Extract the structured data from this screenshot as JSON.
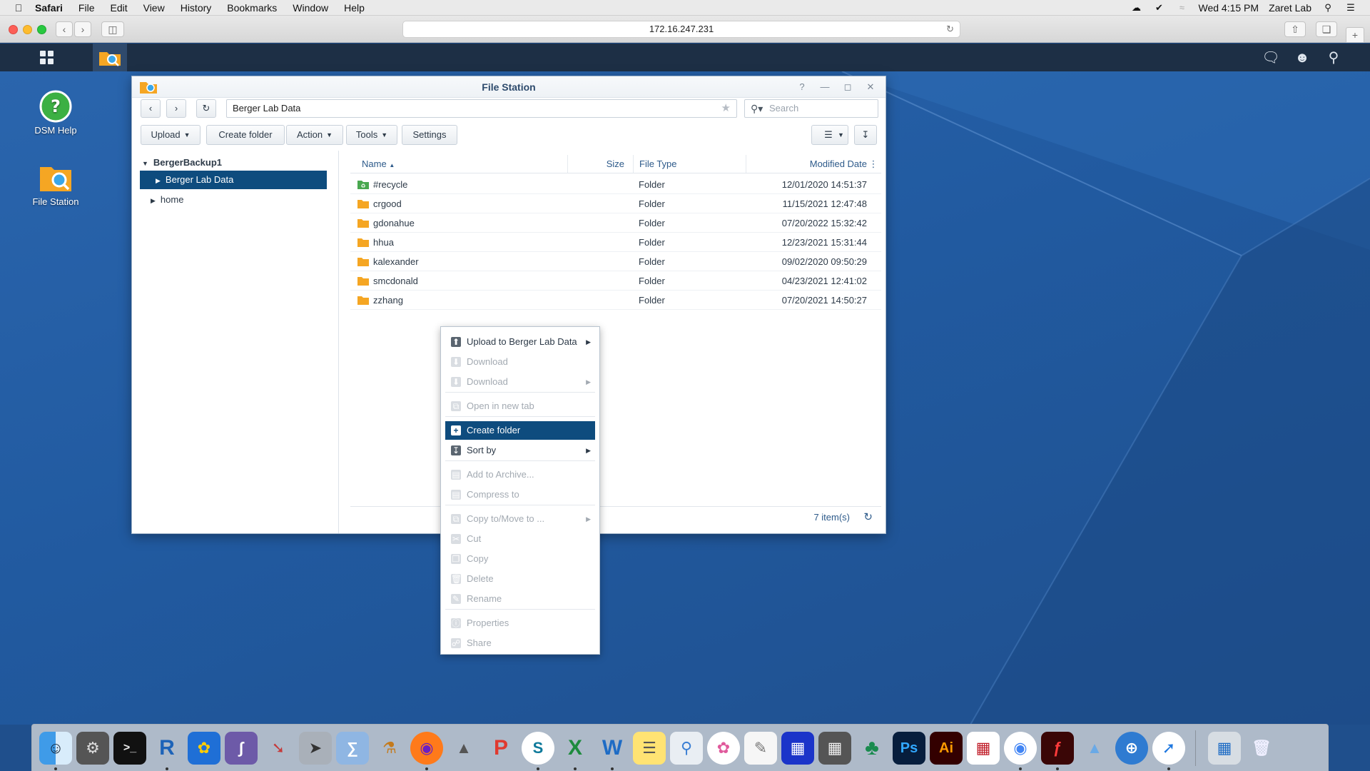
{
  "menubar": {
    "app": "Safari",
    "items": [
      "File",
      "Edit",
      "View",
      "History",
      "Bookmarks",
      "Window",
      "Help"
    ],
    "clock": "Wed 4:15 PM",
    "user": "Zaret Lab"
  },
  "safari": {
    "url": "172.16.247.231"
  },
  "desktop": {
    "icons": [
      {
        "label": "DSM Help",
        "icon": "help-icon"
      },
      {
        "label": "File Station",
        "icon": "file-station-icon"
      }
    ]
  },
  "window": {
    "title": "File Station",
    "path": "Berger Lab Data",
    "search_placeholder": "Search",
    "toolbar": {
      "upload": "Upload",
      "create_folder": "Create folder",
      "action": "Action",
      "tools": "Tools",
      "settings": "Settings"
    },
    "tree": {
      "root": "BergerBackup1",
      "selected": "Berger Lab Data",
      "child": "home"
    },
    "columns": {
      "name": "Name",
      "size": "Size",
      "type": "File Type",
      "modified": "Modified Date"
    },
    "rows": [
      {
        "name": "#recycle",
        "size": "",
        "type": "Folder",
        "modified": "12/01/2020 14:51:37",
        "icon": "recycle-folder-icon"
      },
      {
        "name": "crgood",
        "size": "",
        "type": "Folder",
        "modified": "11/15/2021 12:47:48",
        "icon": "folder-icon"
      },
      {
        "name": "gdonahue",
        "size": "",
        "type": "Folder",
        "modified": "07/20/2022 15:32:42",
        "icon": "folder-icon"
      },
      {
        "name": "hhua",
        "size": "",
        "type": "Folder",
        "modified": "12/23/2021 15:31:44",
        "icon": "folder-icon"
      },
      {
        "name": "kalexander",
        "size": "",
        "type": "Folder",
        "modified": "09/02/2020 09:50:29",
        "icon": "folder-icon"
      },
      {
        "name": "smcdonald",
        "size": "",
        "type": "Folder",
        "modified": "04/23/2021 12:41:02",
        "icon": "folder-icon"
      },
      {
        "name": "zzhang",
        "size": "",
        "type": "Folder",
        "modified": "07/20/2021 14:50:27",
        "icon": "folder-icon"
      }
    ],
    "item_count": "7 item(s)"
  },
  "context_menu": {
    "items": [
      {
        "label": "Upload to Berger Lab Data",
        "icon": "upload-icon",
        "enabled": true,
        "submenu": true
      },
      {
        "label": "Download",
        "icon": "download-icon",
        "enabled": false,
        "submenu": false
      },
      {
        "label": "Download",
        "icon": "download-icon",
        "enabled": false,
        "submenu": true
      },
      {
        "label": "Open in new tab",
        "icon": "new-tab-icon",
        "enabled": false,
        "submenu": false
      },
      {
        "label": "Create folder",
        "icon": "create-folder-icon",
        "enabled": true,
        "submenu": false,
        "highlighted": true
      },
      {
        "label": "Sort by",
        "icon": "sort-icon",
        "enabled": true,
        "submenu": true
      },
      {
        "label": "Add to Archive...",
        "icon": "archive-icon",
        "enabled": false,
        "submenu": false
      },
      {
        "label": "Compress to",
        "icon": "compress-icon",
        "enabled": false,
        "submenu": false
      },
      {
        "label": "Copy to/Move to ...",
        "icon": "copy-move-icon",
        "enabled": false,
        "submenu": true
      },
      {
        "label": "Cut",
        "icon": "cut-icon",
        "enabled": false,
        "submenu": false
      },
      {
        "label": "Copy",
        "icon": "copy-icon",
        "enabled": false,
        "submenu": false
      },
      {
        "label": "Delete",
        "icon": "delete-icon",
        "enabled": false,
        "submenu": false
      },
      {
        "label": "Rename",
        "icon": "rename-icon",
        "enabled": false,
        "submenu": false
      },
      {
        "label": "Properties",
        "icon": "properties-icon",
        "enabled": false,
        "submenu": false
      },
      {
        "label": "Share",
        "icon": "share-icon",
        "enabled": false,
        "submenu": false
      }
    ]
  },
  "colors": {
    "selection": "#0e4c7e",
    "dsm_bar": "#1d2f45",
    "folder": "#f5a623",
    "desktop": "#215aa0"
  }
}
